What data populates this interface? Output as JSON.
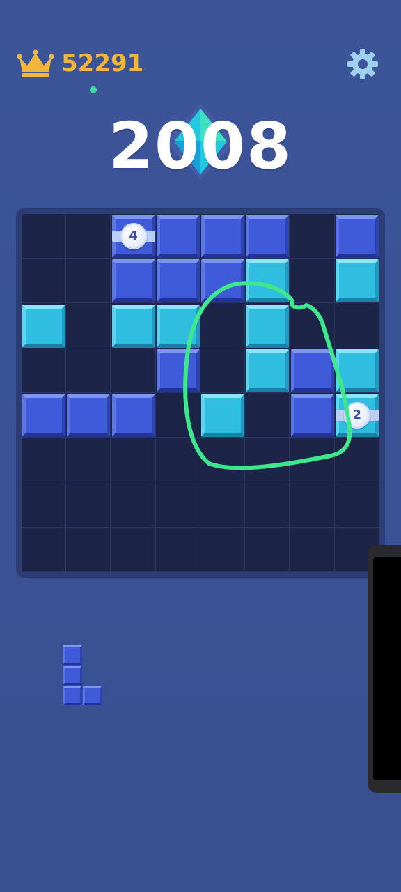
{
  "header": {
    "best_score": "52291",
    "crown_icon": "crown-icon",
    "settings_icon": "gear-icon",
    "best_color": "#f4b63a"
  },
  "score": {
    "current": "2008",
    "badge_icon": "diamond-icon"
  },
  "board": {
    "size": 8,
    "colors": {
      "blue": "#3f5bd9",
      "cyan": "#2fbde0",
      "empty": "#1c2448"
    },
    "cells": [
      {
        "row": 0,
        "col": 2,
        "color": "blue",
        "coin": "4"
      },
      {
        "row": 0,
        "col": 3,
        "color": "blue"
      },
      {
        "row": 0,
        "col": 4,
        "color": "blue"
      },
      {
        "row": 0,
        "col": 5,
        "color": "blue"
      },
      {
        "row": 0,
        "col": 7,
        "color": "blue"
      },
      {
        "row": 1,
        "col": 2,
        "color": "blue"
      },
      {
        "row": 1,
        "col": 3,
        "color": "blue"
      },
      {
        "row": 1,
        "col": 4,
        "color": "blue"
      },
      {
        "row": 1,
        "col": 5,
        "color": "cyan"
      },
      {
        "row": 1,
        "col": 7,
        "color": "cyan"
      },
      {
        "row": 2,
        "col": 0,
        "color": "cyan"
      },
      {
        "row": 2,
        "col": 2,
        "color": "cyan"
      },
      {
        "row": 2,
        "col": 3,
        "color": "cyan"
      },
      {
        "row": 2,
        "col": 5,
        "color": "cyan"
      },
      {
        "row": 3,
        "col": 3,
        "color": "blue"
      },
      {
        "row": 3,
        "col": 5,
        "color": "cyan"
      },
      {
        "row": 3,
        "col": 6,
        "color": "blue"
      },
      {
        "row": 3,
        "col": 7,
        "color": "cyan"
      },
      {
        "row": 4,
        "col": 0,
        "color": "blue"
      },
      {
        "row": 4,
        "col": 1,
        "color": "blue"
      },
      {
        "row": 4,
        "col": 2,
        "color": "blue"
      },
      {
        "row": 4,
        "col": 4,
        "color": "cyan"
      },
      {
        "row": 4,
        "col": 6,
        "color": "blue"
      },
      {
        "row": 4,
        "col": 7,
        "color": "cyan",
        "coin": "2"
      }
    ]
  },
  "tray": {
    "piece": {
      "shape": "L",
      "color": "blue",
      "cells": [
        [
          0,
          0
        ],
        [
          1,
          0
        ],
        [
          2,
          0
        ],
        [
          2,
          1
        ]
      ]
    }
  },
  "annotation": {
    "color": "#3ee68c"
  }
}
